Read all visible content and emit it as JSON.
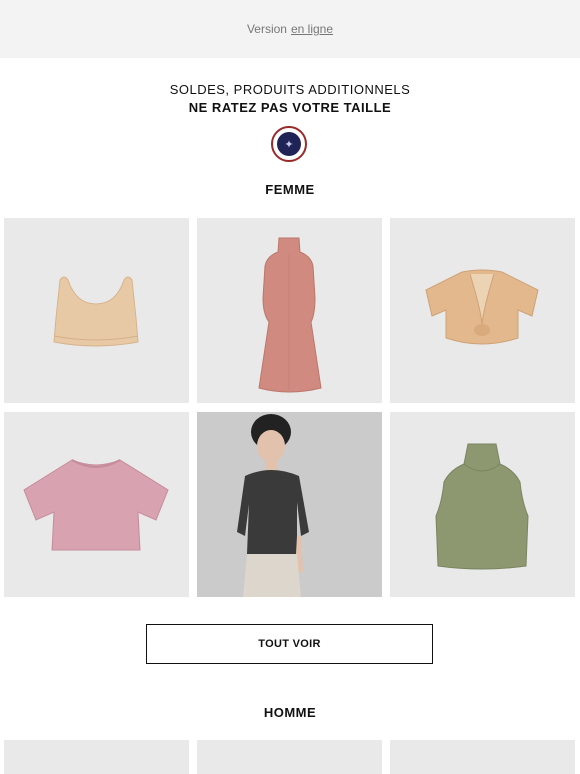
{
  "topbar": {
    "prefix": "Version",
    "link": "en ligne"
  },
  "headline": {
    "line1": "SOLDES, PRODUITS ADDITIONNELS",
    "line2": "NE RATEZ PAS VOTRE TAILLE"
  },
  "logo": {
    "icon": "brand-seal-icon"
  },
  "women": {
    "title": "FEMME",
    "products": [
      {
        "name": "bralette",
        "color": "#e8c9a6"
      },
      {
        "name": "robe-col-roule",
        "color": "#d08a7f"
      },
      {
        "name": "cardigan-court",
        "color": "#e3b88c"
      },
      {
        "name": "t-shirt-court",
        "color": "#d9a2b0"
      },
      {
        "name": "modele-haut-noir",
        "color": "#3a3a3a"
      },
      {
        "name": "debardeur-col-roule",
        "color": "#8e9870"
      }
    ],
    "cta": "TOUT VOIR"
  },
  "men": {
    "title": "HOMME"
  },
  "colors": {
    "tile_bg": "#e9e9e9",
    "topbar_bg": "#f3f3f3",
    "logo_ring": "#9b2a2a",
    "logo_center": "#1f2355"
  }
}
